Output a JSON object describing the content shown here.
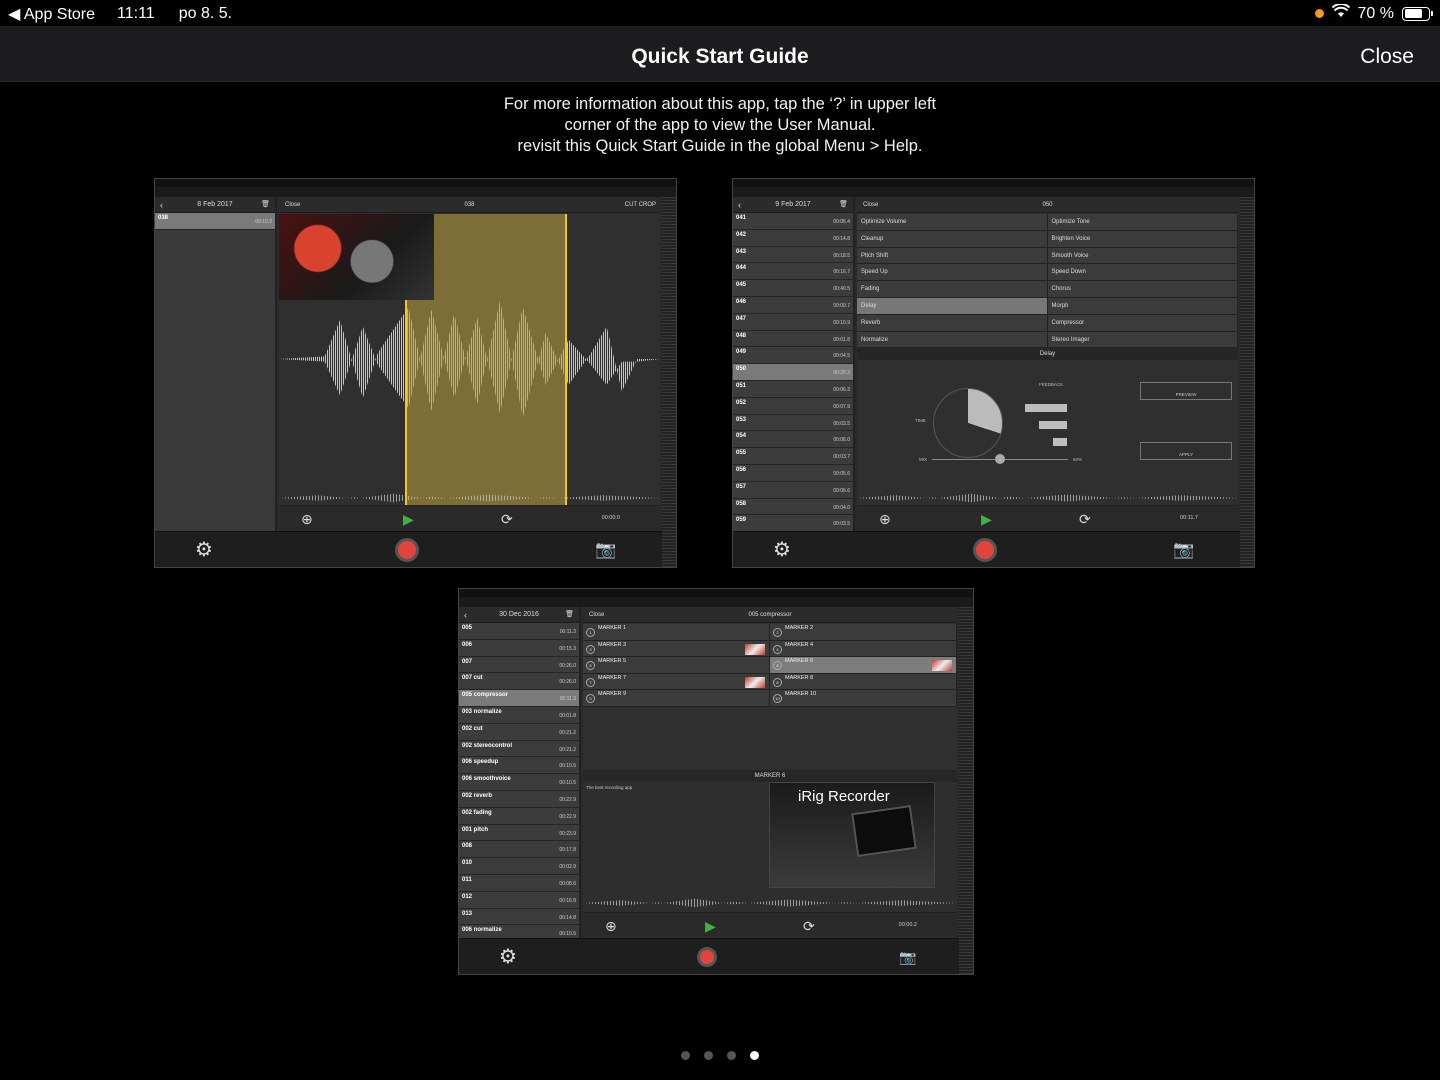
{
  "status": {
    "back_label": "App Store",
    "time": "11:11",
    "date": "po 8. 5.",
    "battery": "70 %"
  },
  "nav": {
    "title": "Quick Start Guide",
    "close": "Close"
  },
  "info": [
    "For more information about this app, tap the ‘?’ in upper left",
    "corner of the app to view the User Manual.",
    "revisit this Quick Start Guide in the global Menu > Help."
  ],
  "shot1": {
    "sidebar_title": "8 Feb 2017",
    "recording": {
      "name": "038",
      "duration": "00:10.2"
    },
    "header": {
      "close": "Close",
      "title": "038",
      "right": "CUT   CROP"
    },
    "time": "00:00.0"
  },
  "shot2": {
    "sidebar_title": "9 Feb 2017",
    "header": {
      "close": "Close",
      "title": "050"
    },
    "recordings": [
      {
        "name": "041",
        "duration": "00:06.4"
      },
      {
        "name": "042",
        "duration": "00:14.8"
      },
      {
        "name": "043",
        "duration": "00:18.5"
      },
      {
        "name": "044",
        "duration": "00:16.7"
      },
      {
        "name": "045",
        "duration": "00:40.5"
      },
      {
        "name": "046",
        "duration": "00:09.7"
      },
      {
        "name": "047",
        "duration": "00:10.9"
      },
      {
        "name": "048",
        "duration": "00:01.8"
      },
      {
        "name": "049",
        "duration": "00:04.5"
      },
      {
        "name": "050",
        "duration": "00:28.3"
      },
      {
        "name": "051",
        "duration": "00:06.3"
      },
      {
        "name": "052",
        "duration": "00:07.9"
      },
      {
        "name": "053",
        "duration": "00:03.5"
      },
      {
        "name": "054",
        "duration": "00:06.0"
      },
      {
        "name": "055",
        "duration": "00:03.7"
      },
      {
        "name": "056",
        "duration": "00:05.6"
      },
      {
        "name": "057",
        "duration": "00:06.6"
      },
      {
        "name": "058",
        "duration": "00:04.0"
      },
      {
        "name": "059",
        "duration": "00:03.5"
      }
    ],
    "effects": [
      [
        "Optimize Volume",
        "Optimize Tone"
      ],
      [
        "Cleanup",
        "Brighten Voice"
      ],
      [
        "Pitch Shift",
        "Smooth Voice"
      ],
      [
        "Speed Up",
        "Speed Down"
      ],
      [
        "Fading",
        "Chorus"
      ],
      [
        "Delay",
        "Morph"
      ],
      [
        "Reverb",
        "Compressor"
      ],
      [
        "Normalize",
        "Stereo Imager"
      ]
    ],
    "panel_title": "Delay",
    "labels": {
      "feedback": "FEEDBACK",
      "time": "TIME",
      "mix": "MIX",
      "mix_value": "60%",
      "preview": "PREVIEW",
      "apply": "APPLY"
    },
    "time": "00:11.7"
  },
  "shot3": {
    "sidebar_title": "30 Dec 2016",
    "header": {
      "close": "Close",
      "title": "005 compressor"
    },
    "recordings": [
      {
        "name": "005",
        "duration": "00:11.3"
      },
      {
        "name": "006",
        "duration": "00:15.3"
      },
      {
        "name": "007",
        "duration": "00:26.0"
      },
      {
        "name": "007 cut",
        "duration": "00:26.0"
      },
      {
        "name": "005 compressor",
        "duration": "00:11.3"
      },
      {
        "name": "003 normalize",
        "duration": "00:01.8"
      },
      {
        "name": "002 cut",
        "duration": "00:21.2"
      },
      {
        "name": "002 stereocontrol",
        "duration": "00:21.2"
      },
      {
        "name": "006 speedup",
        "duration": "00:10.5"
      },
      {
        "name": "006 smoothvoice",
        "duration": "00:10.5"
      },
      {
        "name": "002 reverb",
        "duration": "00:22.9"
      },
      {
        "name": "002 fading",
        "duration": "00:22.9"
      },
      {
        "name": "001 pitch",
        "duration": "00:23.9"
      },
      {
        "name": "008",
        "duration": "00:17.8"
      },
      {
        "name": "010",
        "duration": "00:02.9"
      },
      {
        "name": "011",
        "duration": "00:08.6"
      },
      {
        "name": "012",
        "duration": "00:16.9"
      },
      {
        "name": "013",
        "duration": "00:14.8"
      },
      {
        "name": "006 normalize",
        "duration": "00:10.5"
      }
    ],
    "markers": [
      [
        {
          "n": "1",
          "label": "MARKER 1"
        },
        {
          "n": "2",
          "label": "MARKER 2"
        }
      ],
      [
        {
          "n": "3",
          "label": "MARKER 3"
        },
        {
          "n": "4",
          "label": "MARKER 4"
        }
      ],
      [
        {
          "n": "5",
          "label": "MARKER 5"
        },
        {
          "n": "6",
          "label": "MARKER 6"
        }
      ],
      [
        {
          "n": "7",
          "label": "MARKER 7"
        },
        {
          "n": "8",
          "label": "MARKER 8"
        }
      ],
      [
        {
          "n": "9",
          "label": "MARKER 9"
        },
        {
          "n": "10",
          "label": "MARKER 10"
        }
      ]
    ],
    "detail_title": "MARKER 6",
    "detail_text": "The best recording app",
    "ad": {
      "brand": "iRig Recorder"
    },
    "time": "00:00.2"
  },
  "pager": {
    "count": 4,
    "active": 3
  }
}
